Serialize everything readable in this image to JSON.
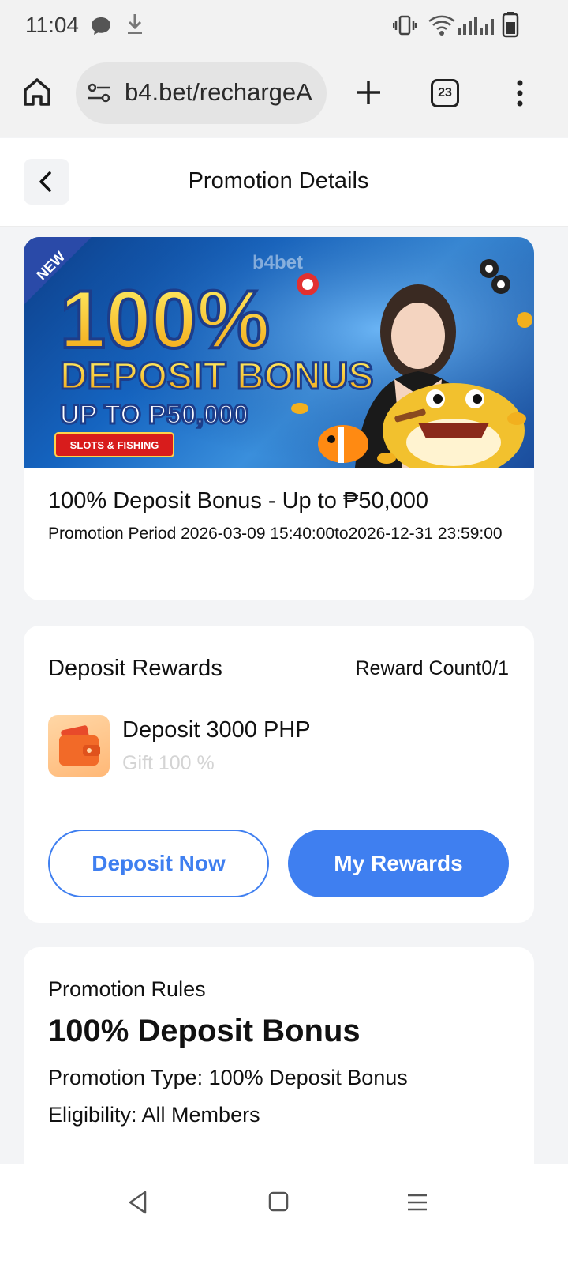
{
  "status_bar": {
    "time": "11:04"
  },
  "browser": {
    "url": "b4.bet/rechargeA",
    "tab_count": "23"
  },
  "header": {
    "title": "Promotion Details"
  },
  "banner": {
    "badge": "NEW",
    "brand": "b4bet",
    "headline": "100%",
    "subheadline": "DEPOSIT BONUS",
    "upto": "UP TO P50,000",
    "tag": "SLOTS & FISHING"
  },
  "promotion": {
    "title": "100% Deposit Bonus - Up to ₱50,000",
    "period": "Promotion Period 2026-03-09 15:40:00to2026-12-31 23:59:00"
  },
  "rewards": {
    "title": "Deposit Rewards",
    "count": "Reward Count0/1",
    "deposit": "Deposit 3000 PHP",
    "gift": "Gift 100 %",
    "deposit_now": "Deposit Now",
    "my_rewards": "My Rewards"
  },
  "rules": {
    "label": "Promotion Rules",
    "heading": "100% Deposit Bonus",
    "type": "Promotion Type: 100% Deposit Bonus",
    "eligibility": "Eligibility: All Members"
  },
  "colors": {
    "accent": "#3f7ff0",
    "page_bg": "#f3f4f6"
  }
}
